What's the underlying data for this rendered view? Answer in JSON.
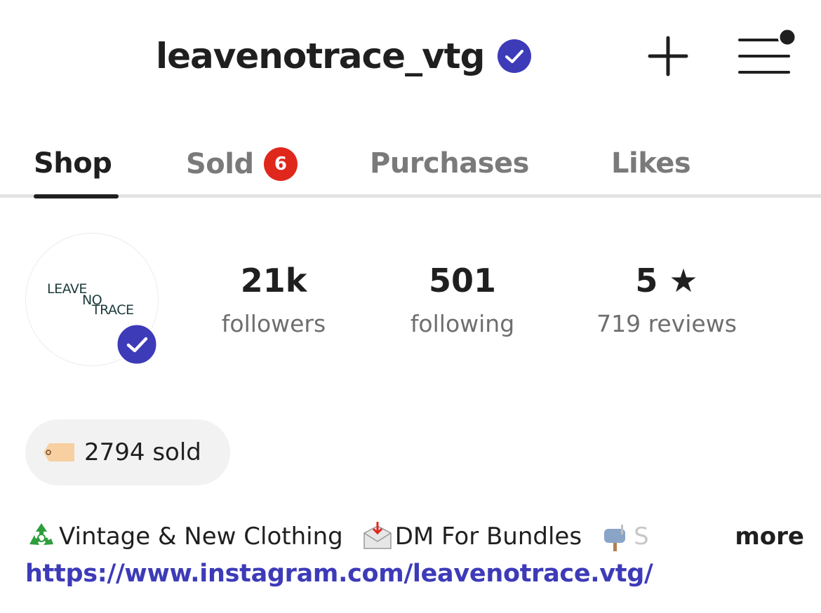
{
  "header": {
    "username": "leavenotrace_vtg",
    "verified_icon": "verified-check-icon",
    "add_icon": "plus-icon",
    "menu_icon": "hamburger-menu-icon",
    "menu_has_notification_dot": true
  },
  "tabs": [
    {
      "label": "Shop",
      "active": true
    },
    {
      "label": "Sold",
      "badge": "6"
    },
    {
      "label": "Purchases"
    },
    {
      "label": "Likes"
    }
  ],
  "profile": {
    "logo_lines": [
      "LEAVE",
      "NO",
      "TRACE"
    ],
    "stats": {
      "followers": {
        "value": "21k",
        "label": "followers"
      },
      "following": {
        "value": "501",
        "label": "following"
      },
      "rating": {
        "value": "5 ★",
        "label": "719 reviews"
      }
    },
    "sold_pill": {
      "icon": "price-tag-icon",
      "text": "2794 sold"
    },
    "bio": {
      "segments": [
        {
          "icon": "recycle-icon",
          "text": "Vintage & New Clothing"
        },
        {
          "icon": "envelope-arrow-icon",
          "text": "DM For Bundles"
        },
        {
          "icon": "mailbox-icon",
          "text": "S"
        }
      ],
      "more_label": "more",
      "link": "https://www.instagram.com/leavenotrace.vtg/"
    }
  },
  "colors": {
    "accent": "#3d3bb8",
    "badge_red": "#e0271c",
    "text_dark": "#1f1f1f",
    "text_muted": "#6e6e6e",
    "pill_bg": "#f2f2f2"
  }
}
